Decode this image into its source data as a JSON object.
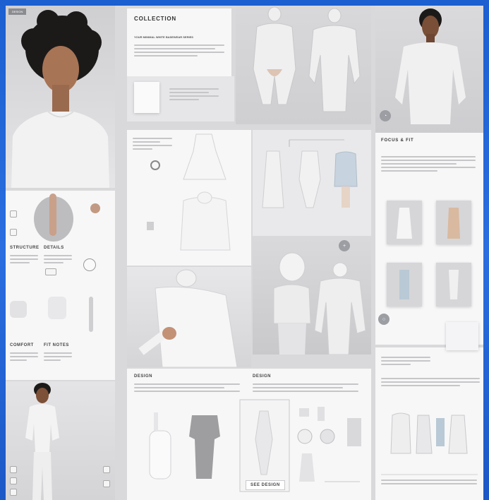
{
  "top_left_label": "DESIGN",
  "collection": {
    "title": "COLLECTION",
    "subtitle": "YOUR MINIMAL WHITE BASEWEAR SERIES"
  },
  "right_panel": {
    "title": "FOCUS & FIT"
  },
  "bottom_panel": {
    "label_a": "DESIGN",
    "label_b": "DESIGN",
    "badge": "SEE DESIGN"
  },
  "left_column": {
    "label_a": "STRUCTURE",
    "label_b": "DETAILS",
    "label_c": "COMFORT",
    "label_d": "FIT NOTES"
  },
  "colors": {
    "background": "#1f63d6",
    "panel": "#f1f1f2",
    "garment": "#f4f4f5",
    "skin": "#a87456"
  }
}
